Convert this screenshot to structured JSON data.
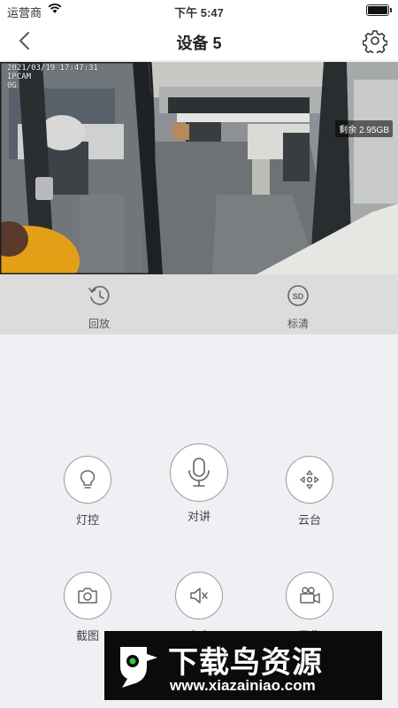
{
  "status_bar": {
    "carrier": "运营商",
    "time": "下午 5:47"
  },
  "nav": {
    "title": "设备 5",
    "back_icon": "chevron-left-icon",
    "settings_icon": "gear-icon"
  },
  "video": {
    "osd_line1": "2021/03/19 17:47:31",
    "osd_line2": "IPCAM",
    "osd_line3": "0G",
    "remaining_storage": "剩余 2.95GB"
  },
  "playback_strip": {
    "playback_label": "回放",
    "quality_label": "标清",
    "quality_badge": "SD"
  },
  "controls": {
    "light_label": "灯控",
    "talk_label": "对讲",
    "ptz_label": "云台",
    "snapshot_label": "截图",
    "mute_label": "声音",
    "record_label": "录像"
  },
  "watermark": {
    "title": "下载鸟资源",
    "url": "www.xiazainiao.com"
  }
}
